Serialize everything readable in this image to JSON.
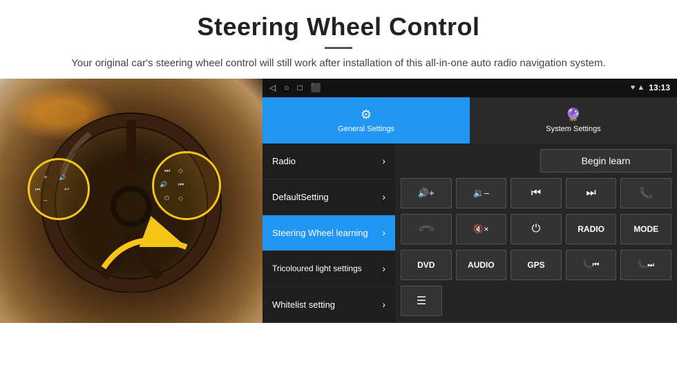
{
  "header": {
    "title": "Steering Wheel Control",
    "divider": true,
    "subtitle": "Your original car's steering wheel control will still work after installation of this all-in-one auto radio navigation system."
  },
  "statusBar": {
    "icons": [
      "◁",
      "○",
      "□",
      "⬛"
    ],
    "rightIcons": "♥ ▲",
    "time": "13:13"
  },
  "tabs": [
    {
      "id": "general",
      "label": "General Settings",
      "active": true
    },
    {
      "id": "system",
      "label": "System Settings",
      "active": false
    }
  ],
  "menu": [
    {
      "id": "radio",
      "label": "Radio",
      "active": false
    },
    {
      "id": "default",
      "label": "DefaultSetting",
      "active": false
    },
    {
      "id": "steering",
      "label": "Steering Wheel learning",
      "active": true
    },
    {
      "id": "tricolour",
      "label": "Tricoloured light settings",
      "active": false
    },
    {
      "id": "whitelist",
      "label": "Whitelist setting",
      "active": false
    }
  ],
  "rightPanel": {
    "beginLearnLabel": "Begin learn",
    "row1": [
      {
        "id": "vol-up",
        "symbol": "🔊+",
        "type": "icon"
      },
      {
        "id": "vol-down",
        "symbol": "🔉–",
        "type": "icon"
      },
      {
        "id": "prev-track",
        "symbol": "⏮",
        "type": "icon"
      },
      {
        "id": "next-track",
        "symbol": "⏭",
        "type": "icon"
      },
      {
        "id": "phone",
        "symbol": "📞",
        "type": "icon"
      }
    ],
    "row2": [
      {
        "id": "hang-up",
        "symbol": "↩",
        "type": "icon"
      },
      {
        "id": "mute",
        "symbol": "🔇×",
        "type": "icon"
      },
      {
        "id": "power",
        "symbol": "⏻",
        "type": "icon"
      },
      {
        "id": "radio-btn",
        "symbol": "RADIO",
        "type": "text"
      },
      {
        "id": "mode-btn",
        "symbol": "MODE",
        "type": "text"
      }
    ],
    "row3": [
      {
        "id": "dvd-btn",
        "symbol": "DVD",
        "type": "text"
      },
      {
        "id": "audio-btn",
        "symbol": "AUDIO",
        "type": "text"
      },
      {
        "id": "gps-btn",
        "symbol": "GPS",
        "type": "text"
      },
      {
        "id": "tel-prev",
        "symbol": "📞⏮",
        "type": "icon"
      },
      {
        "id": "tel-next",
        "symbol": "📞⏭",
        "type": "icon"
      }
    ],
    "row4": [
      {
        "id": "eq-icon",
        "symbol": "☰",
        "type": "icon"
      }
    ]
  }
}
